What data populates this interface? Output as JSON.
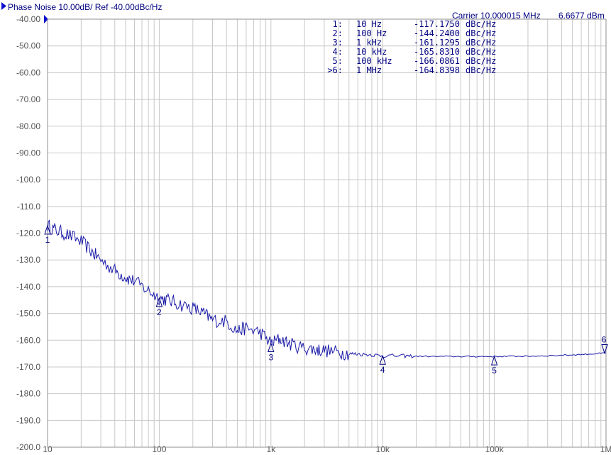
{
  "header": {
    "title": "Phase Noise 10.00dB/ Ref -40.00dBc/Hz",
    "carrier": "Carrier 10.000015 MHz",
    "power": "6.6677 dBm"
  },
  "marker_table": [
    {
      "idx": "1:",
      "freq": "10 Hz",
      "value": "-117.1750",
      "unit": "dBc/Hz"
    },
    {
      "idx": "2:",
      "freq": "100 Hz",
      "value": "-144.2400",
      "unit": "dBc/Hz"
    },
    {
      "idx": "3:",
      "freq": "1 kHz",
      "value": "-161.1295",
      "unit": "dBc/Hz"
    },
    {
      "idx": "4:",
      "freq": "10 kHz",
      "value": "-165.8310",
      "unit": "dBc/Hz"
    },
    {
      "idx": "5:",
      "freq": "100 kHz",
      "value": "-166.0861",
      "unit": "dBc/Hz"
    },
    {
      "idx": ">6:",
      "freq": "1 MHz",
      "value": "-164.8398",
      "unit": "dBc/Hz"
    }
  ],
  "colors": {
    "trace": "#1a1aa8",
    "text": "#000080",
    "grid": "#c8c8c8",
    "axis_text": "#555555"
  },
  "chart_data": {
    "type": "line",
    "title": "Phase Noise 10.00dB/ Ref -40.00dBc/Hz",
    "x_scale": "log",
    "xlim": [
      10,
      1000000
    ],
    "ylim": [
      -200,
      -40
    ],
    "grid": true,
    "y_ticks": [
      "-40.00",
      "-50.00",
      "-60.00",
      "-70.00",
      "-80.00",
      "-90.00",
      "-100.0",
      "-110.0",
      "-120.0",
      "-130.0",
      "-140.0",
      "-150.0",
      "-160.0",
      "-170.0",
      "-180.0",
      "-190.0",
      "-200.0"
    ],
    "x_ticks": [
      {
        "value": 10,
        "label": "10"
      },
      {
        "value": 100,
        "label": "100"
      },
      {
        "value": 1000,
        "label": "1k"
      },
      {
        "value": 10000,
        "label": "10k"
      },
      {
        "value": 100000,
        "label": "100k"
      },
      {
        "value": 1000000,
        "label": "1M"
      }
    ],
    "series": [
      {
        "x": [
          10,
          12,
          15,
          20,
          25,
          30,
          40,
          50,
          60,
          80,
          100,
          120,
          150,
          200,
          250,
          300,
          400,
          500,
          600,
          800,
          1000,
          1200,
          1500,
          2000,
          2500,
          3000,
          4000,
          5000,
          6000,
          8000,
          10000,
          15000,
          20000,
          30000,
          50000,
          70000,
          100000,
          150000,
          200000,
          300000,
          500000,
          700000,
          1000000
        ],
        "y": [
          -117.2,
          -119,
          -120.5,
          -123,
          -127,
          -130,
          -134,
          -136.5,
          -138,
          -141.5,
          -144.2,
          -145,
          -146.5,
          -148,
          -150,
          -152.5,
          -153,
          -156.5,
          -155.5,
          -157,
          -161.1,
          -159.5,
          -161.5,
          -163,
          -163.5,
          -163.8,
          -164.5,
          -165,
          -165.2,
          -165.5,
          -165.8,
          -165.9,
          -166,
          -166.1,
          -166.1,
          -166.1,
          -166.1,
          -166,
          -166,
          -165.8,
          -165.5,
          -165.2,
          -164.8
        ]
      }
    ],
    "markers": [
      {
        "label": "1",
        "x": 10,
        "y": -117.175,
        "pointer": "up"
      },
      {
        "label": "2",
        "x": 100,
        "y": -144.24,
        "pointer": "up"
      },
      {
        "label": "3",
        "x": 1000,
        "y": -161.1295,
        "pointer": "up"
      },
      {
        "label": "4",
        "x": 10000,
        "y": -165.831,
        "pointer": "up"
      },
      {
        "label": "5",
        "x": 100000,
        "y": -166.0861,
        "pointer": "up"
      },
      {
        "label": "6",
        "x": 1000000,
        "y": -164.8398,
        "pointer": "down"
      }
    ]
  }
}
